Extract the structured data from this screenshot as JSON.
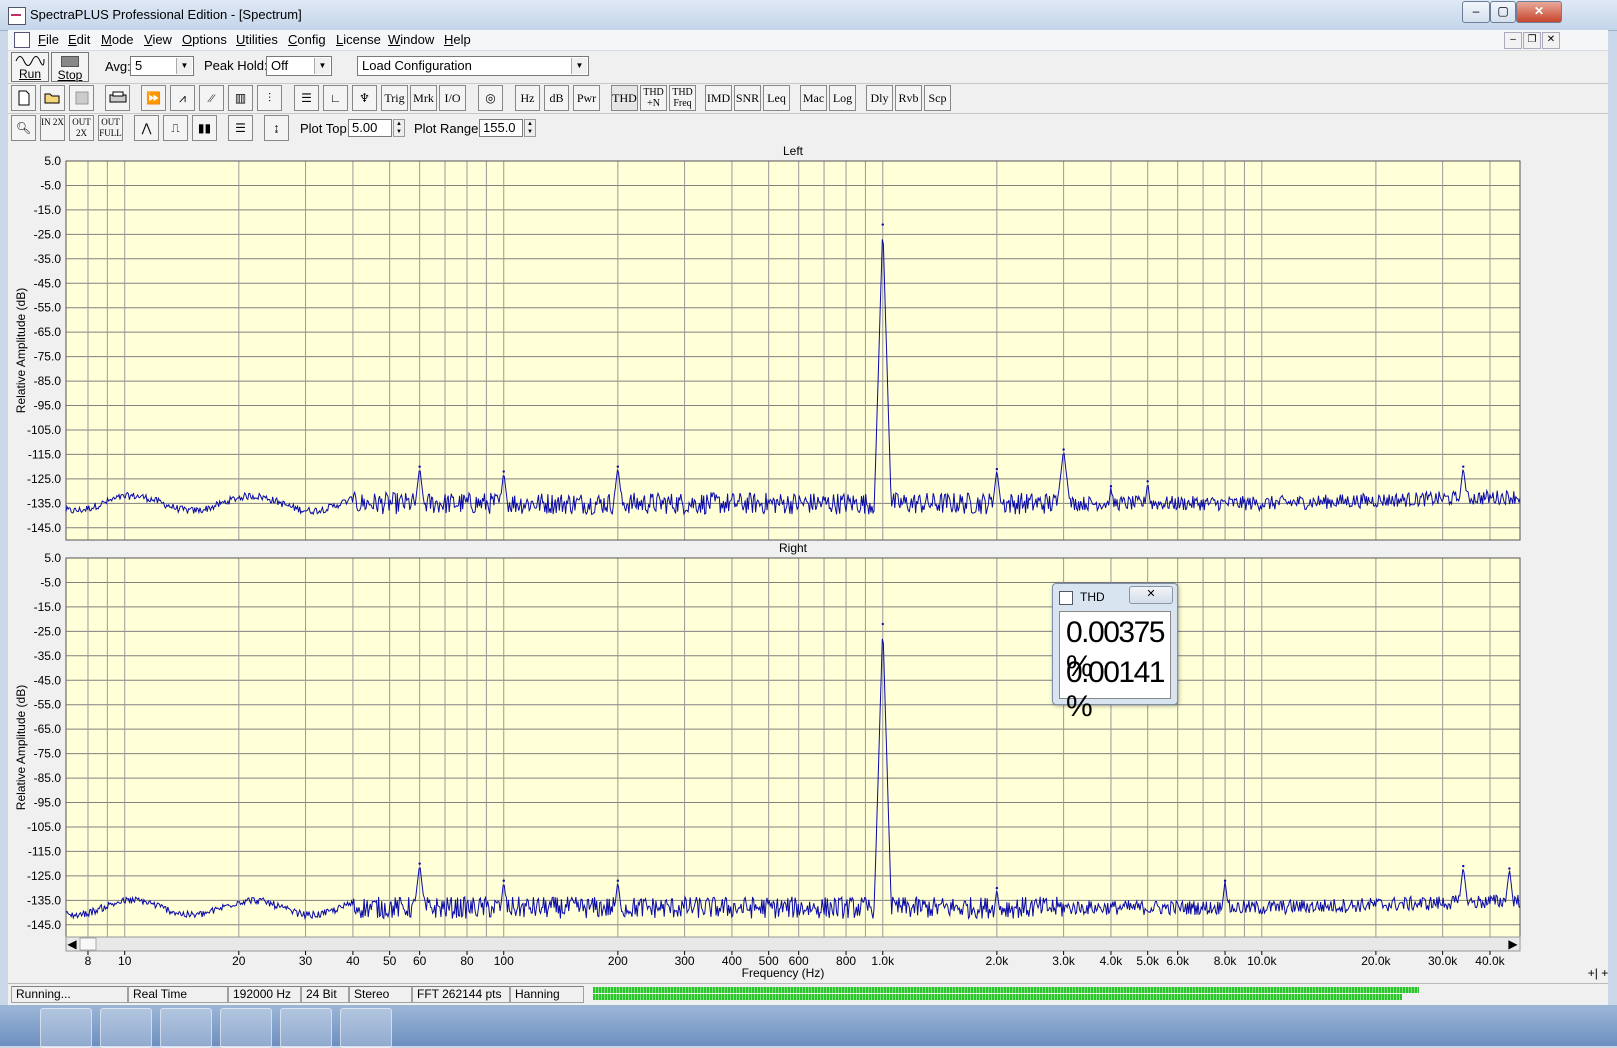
{
  "window": {
    "title": "SpectraPLUS Professional Edition - [Spectrum]",
    "buttons": {
      "minimize": "–",
      "maximize": "▢",
      "close": "✕"
    },
    "mdi_buttons": {
      "minimize": "–",
      "restore": "❐",
      "close": "✕"
    }
  },
  "menu": [
    "File",
    "Edit",
    "Mode",
    "View",
    "Options",
    "Utilities",
    "Config",
    "License",
    "Window",
    "Help"
  ],
  "toolbar1": {
    "run_label": "Run",
    "stop_label": "Stop",
    "avg_label": "Avg:",
    "avg_value": "5",
    "peak_hold_label": "Peak Hold:",
    "peak_hold_value": "Off",
    "config_value": "Load Configuration"
  },
  "toolbar2": {
    "buttons": [
      "Trig",
      "Mrk",
      "I/O",
      "Hz",
      "dB",
      "Pwr",
      "THD",
      "THD +N",
      "THD Freq",
      "IMD",
      "SNR",
      "Leq",
      "Mac",
      "Log",
      "Dly",
      "Rvb",
      "Scp"
    ]
  },
  "toolbar3": {
    "zoom_labels": [
      "IN 2X",
      "OUT 2X",
      "OUT FULL"
    ],
    "plot_top_label": "Plot Top:",
    "plot_top_value": "5.00",
    "plot_range_label": "Plot Range:",
    "plot_range_value": "155.0"
  },
  "plots": {
    "left_title": "Left",
    "right_title": "Right",
    "ylabel": "Relative Amplitude (dB)",
    "xlabel": "Frequency (Hz)",
    "y_ticks": [
      "5.0",
      "-5.0",
      "-15.0",
      "-25.0",
      "-35.0",
      "-45.0",
      "-55.0",
      "-65.0",
      "-75.0",
      "-85.0",
      "-95.0",
      "-105.0",
      "-115.0",
      "-125.0",
      "-135.0",
      "-145.0"
    ],
    "x_ticks": [
      "8",
      "10",
      "20",
      "30",
      "40",
      "50",
      "60",
      "80",
      "100",
      "200",
      "300",
      "400",
      "500",
      "600",
      "800",
      "1.0k",
      "2.0k",
      "3.0k",
      "4.0k",
      "5.0k",
      "6.0k",
      "8.0k",
      "10.0k",
      "20.0k",
      "30.0k",
      "40.0k"
    ],
    "scroll_left": "◀",
    "scroll_right": "▶",
    "plus_marks": "+| +"
  },
  "chart_data": [
    {
      "type": "line",
      "title": "Left",
      "xlabel": "Frequency (Hz)",
      "ylabel": "Relative Amplitude (dB)",
      "x_scale": "log",
      "xlim": [
        7,
        48000
      ],
      "ylim": [
        -150,
        5
      ],
      "grid": true,
      "series_color": "#0a0aa8",
      "noise_floor_db": -135,
      "peaks": [
        {
          "x": 60,
          "y": -120
        },
        {
          "x": 100,
          "y": -122
        },
        {
          "x": 200,
          "y": -120
        },
        {
          "x": 1000,
          "y": -21
        },
        {
          "x": 2000,
          "y": -121
        },
        {
          "x": 3000,
          "y": -113
        },
        {
          "x": 4000,
          "y": -128
        },
        {
          "x": 5000,
          "y": -126
        },
        {
          "x": 34000,
          "y": -120
        }
      ]
    },
    {
      "type": "line",
      "title": "Right",
      "xlabel": "Frequency (Hz)",
      "ylabel": "Relative Amplitude (dB)",
      "x_scale": "log",
      "xlim": [
        7,
        48000
      ],
      "ylim": [
        -150,
        5
      ],
      "grid": true,
      "series_color": "#0a0aa8",
      "noise_floor_db": -138,
      "peaks": [
        {
          "x": 60,
          "y": -120
        },
        {
          "x": 100,
          "y": -127
        },
        {
          "x": 200,
          "y": -127
        },
        {
          "x": 1000,
          "y": -22
        },
        {
          "x": 2000,
          "y": -130
        },
        {
          "x": 8000,
          "y": -127
        },
        {
          "x": 34000,
          "y": -121
        },
        {
          "x": 45000,
          "y": -122
        }
      ]
    }
  ],
  "thd_window": {
    "title": "THD",
    "close": "✕",
    "value_left": "0.00375 %",
    "value_right": "0.00141 %"
  },
  "status": {
    "state": "Running...",
    "mode": "Real Time",
    "sample_rate": "192000 Hz",
    "bits": "24 Bit",
    "channels": "Stereo",
    "fft": "FFT 262144 pts",
    "window": "Hanning",
    "meter_left_level": 1.0,
    "meter_right_level": 0.98
  }
}
